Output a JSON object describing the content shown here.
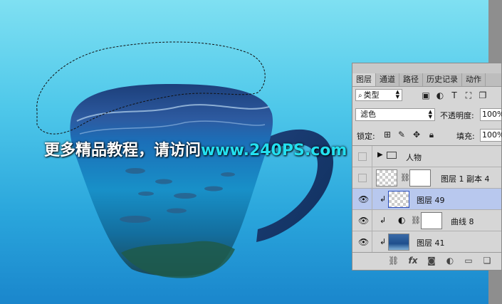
{
  "watermark": {
    "text_cn": "更多精品教程，请访问",
    "text_url": "www.240PS.com"
  },
  "colors": {
    "bg_top": "#7fe0f2",
    "bg_bottom": "#1a86cc",
    "watermark_url": "#23e0f0",
    "selected_layer": "#b8c8ee"
  },
  "panel": {
    "tabs": [
      "图层",
      "通道",
      "路径",
      "历史记录",
      "动作"
    ],
    "filter": {
      "kind_label": "类型",
      "search_icon": "search-icon"
    },
    "blend_mode": "滤色",
    "opacity_label": "不透明度:",
    "opacity_value": "100%",
    "lock_label": "锁定:",
    "fill_label": "填充:",
    "fill_value": "100%",
    "layers": [
      {
        "name": "人物",
        "type": "group",
        "visible": false
      },
      {
        "name": "图层 1 副本 4",
        "type": "layer-with-mask",
        "visible": false
      },
      {
        "name": "图层 49",
        "type": "clipped-layer",
        "visible": true,
        "selected": true
      },
      {
        "name": "曲线 8",
        "type": "curves-adjustment",
        "visible": true
      },
      {
        "name": "图层 41",
        "type": "clipped-smart-layer",
        "visible": true
      }
    ],
    "bottom_icons": [
      "link-icon",
      "fx-icon",
      "mask-icon",
      "adjustment-icon",
      "folder-icon",
      "new-layer-icon"
    ],
    "fx_label": "fx"
  }
}
